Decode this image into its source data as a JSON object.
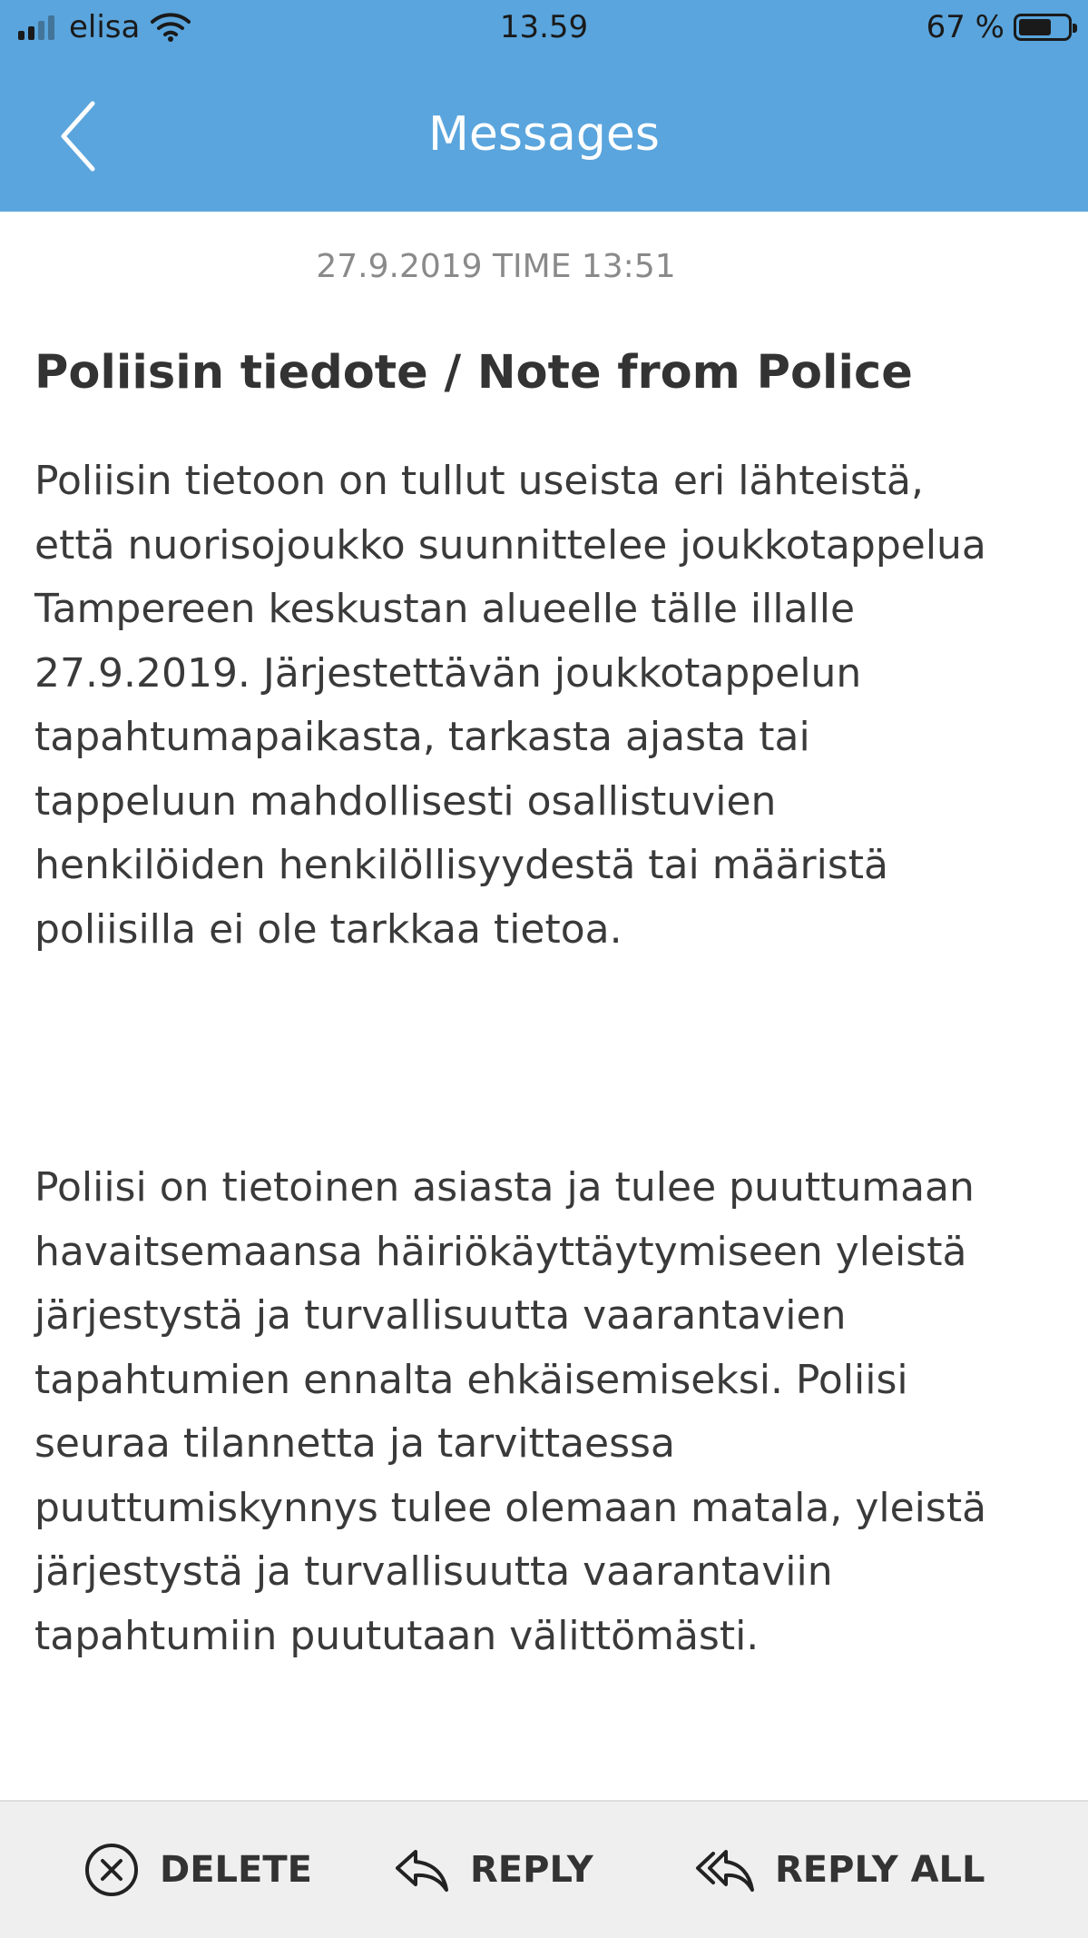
{
  "status_bar": {
    "carrier": "elisa",
    "time": "13.59",
    "battery_percent": "67 %",
    "battery_level": 0.67
  },
  "nav": {
    "title": "Messages",
    "back_icon": "chevron-left-icon"
  },
  "message": {
    "timestamp": "27.9.2019 TIME 13:51",
    "title": "Poliisin tiedote / Note from Police",
    "paragraph1_lines": [
      "Poliisin tietoon on tullut useista eri lähteistä,",
      "että nuorisojoukko suunnittelee joukkotappelua",
      "Tampereen keskustan alueelle tälle illalle",
      "27.9.2019. Järjestettävän joukkotappelun",
      "tapahtumapaikasta, tarkasta ajasta tai",
      "tappeluun mahdollisesti osallistuvien",
      "henkilöiden henkilöllisyydestä tai määristä",
      "poliisilla ei ole tarkkaa tietoa."
    ],
    "paragraph2_lines": [
      "Poliisi on tietoinen asiasta ja tulee puuttumaan",
      "havaitsemaansa häiriökäyttäytymiseen yleistä",
      "järjestystä ja turvallisuutta vaarantavien",
      "tapahtumien ennalta ehkäisemiseksi. Poliisi",
      "seuraa tilannetta ja tarvittaessa",
      "puuttumiskynnys tulee olemaan matala, yleistä",
      "järjestystä ja turvallisuutta vaarantaviin",
      "tapahtumiin puututaan välittömästi."
    ]
  },
  "footer": {
    "delete_label": "DELETE",
    "reply_label": "REPLY",
    "reply_all_label": "REPLY ALL"
  },
  "colors": {
    "header_bg": "#5aa5dd",
    "header_text": "#ffffff",
    "body_text": "#3a3a3a",
    "timestamp_text": "#8a8a8a",
    "footer_bg": "#efefef"
  }
}
